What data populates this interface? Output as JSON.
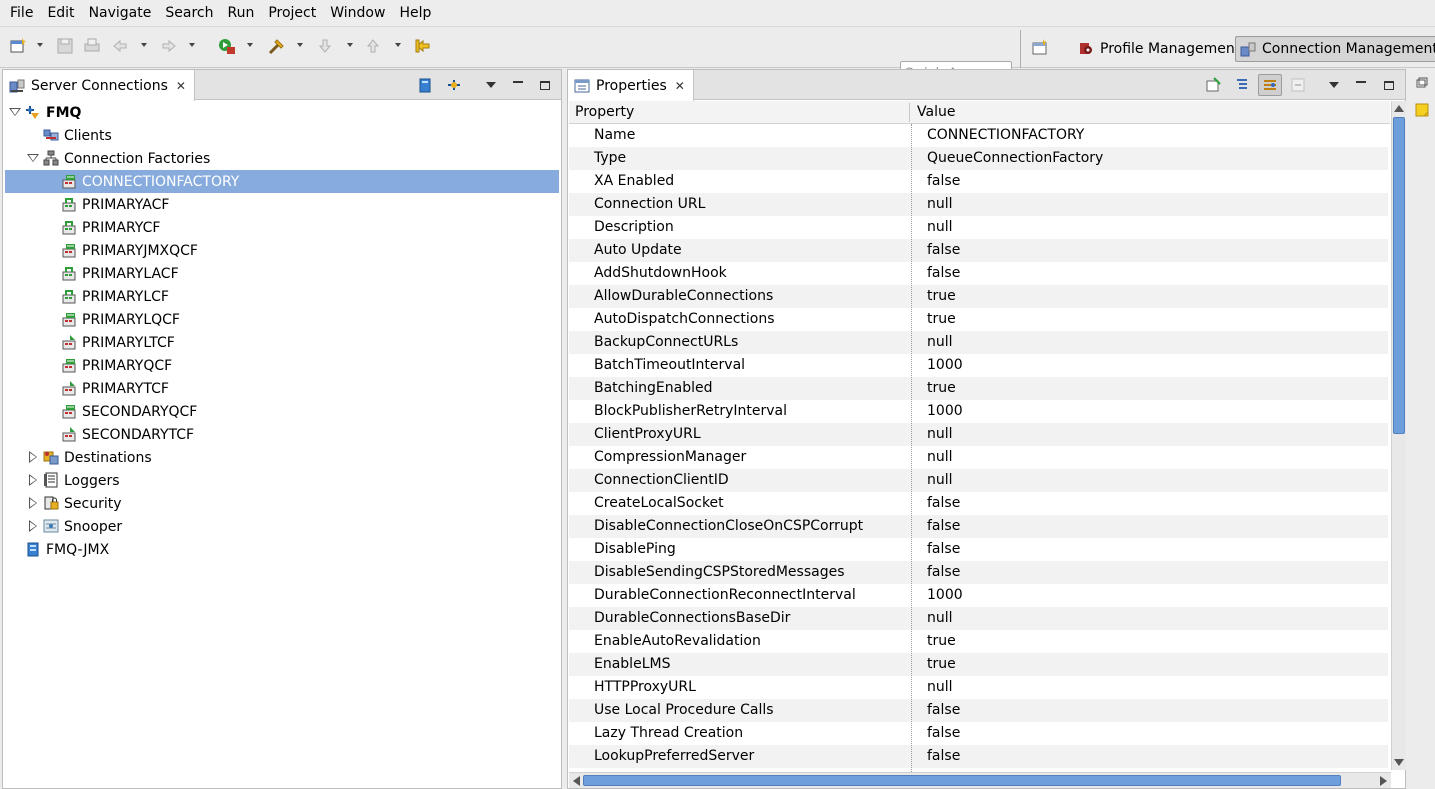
{
  "menubar": {
    "items": [
      "File",
      "Edit",
      "Navigate",
      "Search",
      "Run",
      "Project",
      "Window",
      "Help"
    ]
  },
  "toolbar": {
    "quick_access_placeholder": "Quick Access",
    "perspectives": [
      {
        "label": "Profile Management",
        "icon": "profile-management-icon",
        "active": false
      },
      {
        "label": "Connection Management",
        "icon": "connection-management-icon",
        "active": true
      }
    ]
  },
  "left_panel": {
    "tab_title": "Server Connections",
    "tree": [
      {
        "label": "FMQ",
        "level": 0,
        "expand": "expanded",
        "icon": "server-icon",
        "bold": true
      },
      {
        "label": "Clients",
        "level": 1,
        "expand": "none",
        "icon": "clients-icon"
      },
      {
        "label": "Connection Factories",
        "level": 1,
        "expand": "expanded",
        "icon": "connection-factories-icon"
      },
      {
        "label": "CONNECTIONFACTORY",
        "level": 2,
        "expand": "none",
        "icon": "queue-factory-icon",
        "selected": true
      },
      {
        "label": "PRIMARYACF",
        "level": 2,
        "expand": "none",
        "icon": "factory-icon"
      },
      {
        "label": "PRIMARYCF",
        "level": 2,
        "expand": "none",
        "icon": "factory-icon"
      },
      {
        "label": "PRIMARYJMXQCF",
        "level": 2,
        "expand": "none",
        "icon": "queue-factory-icon"
      },
      {
        "label": "PRIMARYLACF",
        "level": 2,
        "expand": "none",
        "icon": "factory-icon"
      },
      {
        "label": "PRIMARYLCF",
        "level": 2,
        "expand": "none",
        "icon": "factory-icon"
      },
      {
        "label": "PRIMARYLQCF",
        "level": 2,
        "expand": "none",
        "icon": "queue-factory-icon"
      },
      {
        "label": "PRIMARYLTCF",
        "level": 2,
        "expand": "none",
        "icon": "topic-factory-icon"
      },
      {
        "label": "PRIMARYQCF",
        "level": 2,
        "expand": "none",
        "icon": "queue-factory-icon"
      },
      {
        "label": "PRIMARYTCF",
        "level": 2,
        "expand": "none",
        "icon": "topic-factory-icon"
      },
      {
        "label": "SECONDARYQCF",
        "level": 2,
        "expand": "none",
        "icon": "queue-factory-icon"
      },
      {
        "label": "SECONDARYTCF",
        "level": 2,
        "expand": "none",
        "icon": "topic-factory-icon"
      },
      {
        "label": "Destinations",
        "level": 1,
        "expand": "collapsed",
        "icon": "destinations-icon"
      },
      {
        "label": "Loggers",
        "level": 1,
        "expand": "collapsed",
        "icon": "loggers-icon"
      },
      {
        "label": "Security",
        "level": 1,
        "expand": "collapsed",
        "icon": "security-icon"
      },
      {
        "label": "Snooper",
        "level": 1,
        "expand": "collapsed",
        "icon": "snooper-icon"
      },
      {
        "label": "FMQ-JMX",
        "level": 0,
        "expand": "none",
        "icon": "jmx-server-icon"
      }
    ]
  },
  "right_panel": {
    "tab_title": "Properties",
    "columns": [
      "Property",
      "Value"
    ],
    "rows": [
      [
        "Name",
        "CONNECTIONFACTORY"
      ],
      [
        "Type",
        "QueueConnectionFactory"
      ],
      [
        "XA Enabled",
        "false"
      ],
      [
        "Connection URL",
        "null"
      ],
      [
        "Description",
        "null"
      ],
      [
        "Auto Update",
        "false"
      ],
      [
        "AddShutdownHook",
        "false"
      ],
      [
        "AllowDurableConnections",
        "true"
      ],
      [
        "AutoDispatchConnections",
        "true"
      ],
      [
        "BackupConnectURLs",
        "null"
      ],
      [
        "BatchTimeoutInterval",
        "1000"
      ],
      [
        "BatchingEnabled",
        "true"
      ],
      [
        "BlockPublisherRetryInterval",
        "1000"
      ],
      [
        "ClientProxyURL",
        "null"
      ],
      [
        "CompressionManager",
        "null"
      ],
      [
        "ConnectionClientID",
        "null"
      ],
      [
        "CreateLocalSocket",
        "false"
      ],
      [
        "DisableConnectionCloseOnCSPCorrupt",
        "false"
      ],
      [
        "DisablePing",
        "false"
      ],
      [
        "DisableSendingCSPStoredMessages",
        "false"
      ],
      [
        "DurableConnectionReconnectInterval",
        "1000"
      ],
      [
        "DurableConnectionsBaseDir",
        "null"
      ],
      [
        "EnableAutoRevalidation",
        "true"
      ],
      [
        "EnableLMS",
        "true"
      ],
      [
        "HTTPProxyURL",
        "null"
      ],
      [
        "Use Local Procedure Calls",
        "false"
      ],
      [
        "Lazy Thread Creation",
        "false"
      ],
      [
        "LookupPreferredServer",
        "false"
      ]
    ]
  },
  "colors": {
    "selection": "#88abde",
    "scroll_thumb": "#6f9edd",
    "alt_row": "#f2f2f2"
  }
}
